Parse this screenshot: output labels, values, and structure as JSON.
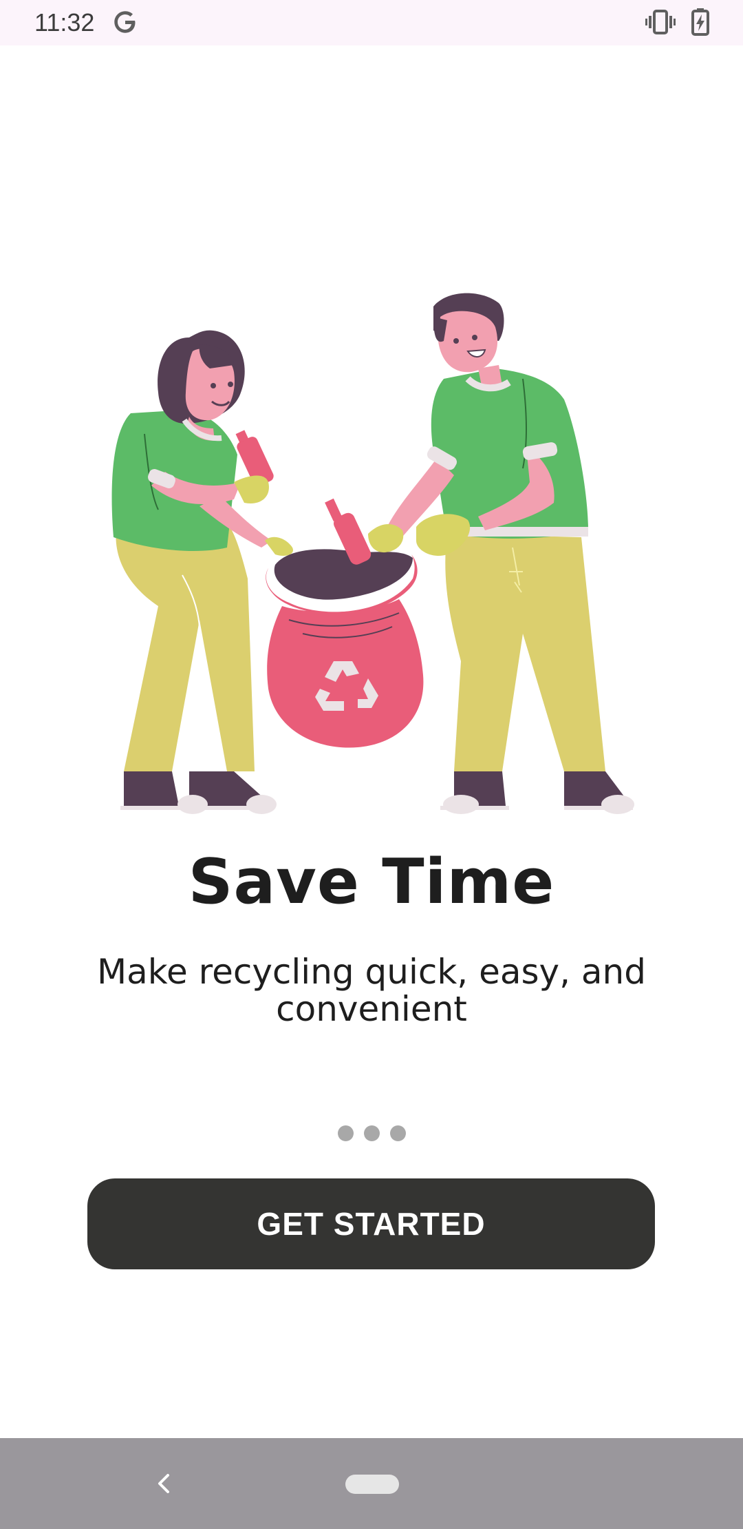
{
  "status_bar": {
    "time": "11:32",
    "icons": [
      "google-g-icon",
      "vibrate-icon",
      "battery-charging-icon"
    ]
  },
  "illustration": {
    "description_icon": "recycling-people-illustration",
    "colors": {
      "shirt": "#5cbb67",
      "pants": "#dbcf6e",
      "skin": "#f2a0b0",
      "hair": "#553f54",
      "bag": "#e95d79",
      "gloves": "#d8d464"
    }
  },
  "onboarding": {
    "title": "Save Time",
    "subtitle": "Make recycling quick, easy, and convenient",
    "page_count": 3
  },
  "cta": {
    "label": "GET STARTED",
    "color": "#343432"
  },
  "nav_bar": {
    "icons": [
      "back-icon",
      "home-pill"
    ]
  }
}
